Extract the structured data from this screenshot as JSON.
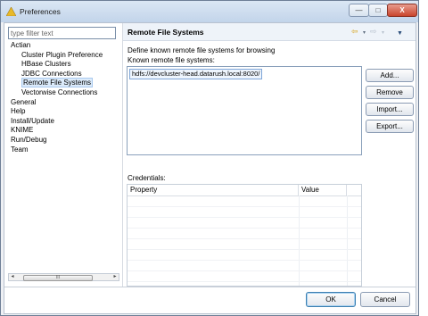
{
  "window": {
    "title": "Preferences"
  },
  "window_controls": {
    "minimize": "—",
    "maximize": "□",
    "close": "X"
  },
  "sidebar": {
    "filter_placeholder": "type filter text",
    "items": [
      {
        "label": "Actian",
        "level": 0,
        "selected": false
      },
      {
        "label": "Cluster Plugin Preference",
        "level": 1,
        "selected": false
      },
      {
        "label": "HBase Clusters",
        "level": 1,
        "selected": false
      },
      {
        "label": "JDBC Connections",
        "level": 1,
        "selected": false
      },
      {
        "label": "Remote File Systems",
        "level": 1,
        "selected": true
      },
      {
        "label": "Vectorwise Connections",
        "level": 1,
        "selected": false
      },
      {
        "label": "General",
        "level": 0,
        "selected": false
      },
      {
        "label": "Help",
        "level": 0,
        "selected": false
      },
      {
        "label": "Install/Update",
        "level": 0,
        "selected": false
      },
      {
        "label": "KNIME",
        "level": 0,
        "selected": false
      },
      {
        "label": "Run/Debug",
        "level": 0,
        "selected": false
      },
      {
        "label": "Team",
        "level": 0,
        "selected": false
      }
    ],
    "scrollbar": {
      "left_arrow": "◂",
      "right_arrow": "▸",
      "thumb_grip": "III"
    }
  },
  "page": {
    "title": "Remote File Systems",
    "description": "Define known remote file systems for browsing",
    "known_label": "Known remote file systems:",
    "file_systems": [
      "hdfs://devcluster-head.datarush.local:8020/"
    ],
    "buttons": {
      "add": "Add...",
      "remove": "Remove",
      "import": "Import...",
      "export": "Export..."
    },
    "credentials_label": "Credentials:",
    "credentials_columns": {
      "property": "Property",
      "value": "Value"
    }
  },
  "nav_icons": {
    "back": "⇦",
    "forward": "⇨",
    "dropdown": "▾",
    "view_menu": "▼"
  },
  "footer": {
    "ok": "OK",
    "cancel": "Cancel"
  },
  "colors": {
    "accent": "#3c7fb1",
    "selection": "#dcebfb"
  }
}
